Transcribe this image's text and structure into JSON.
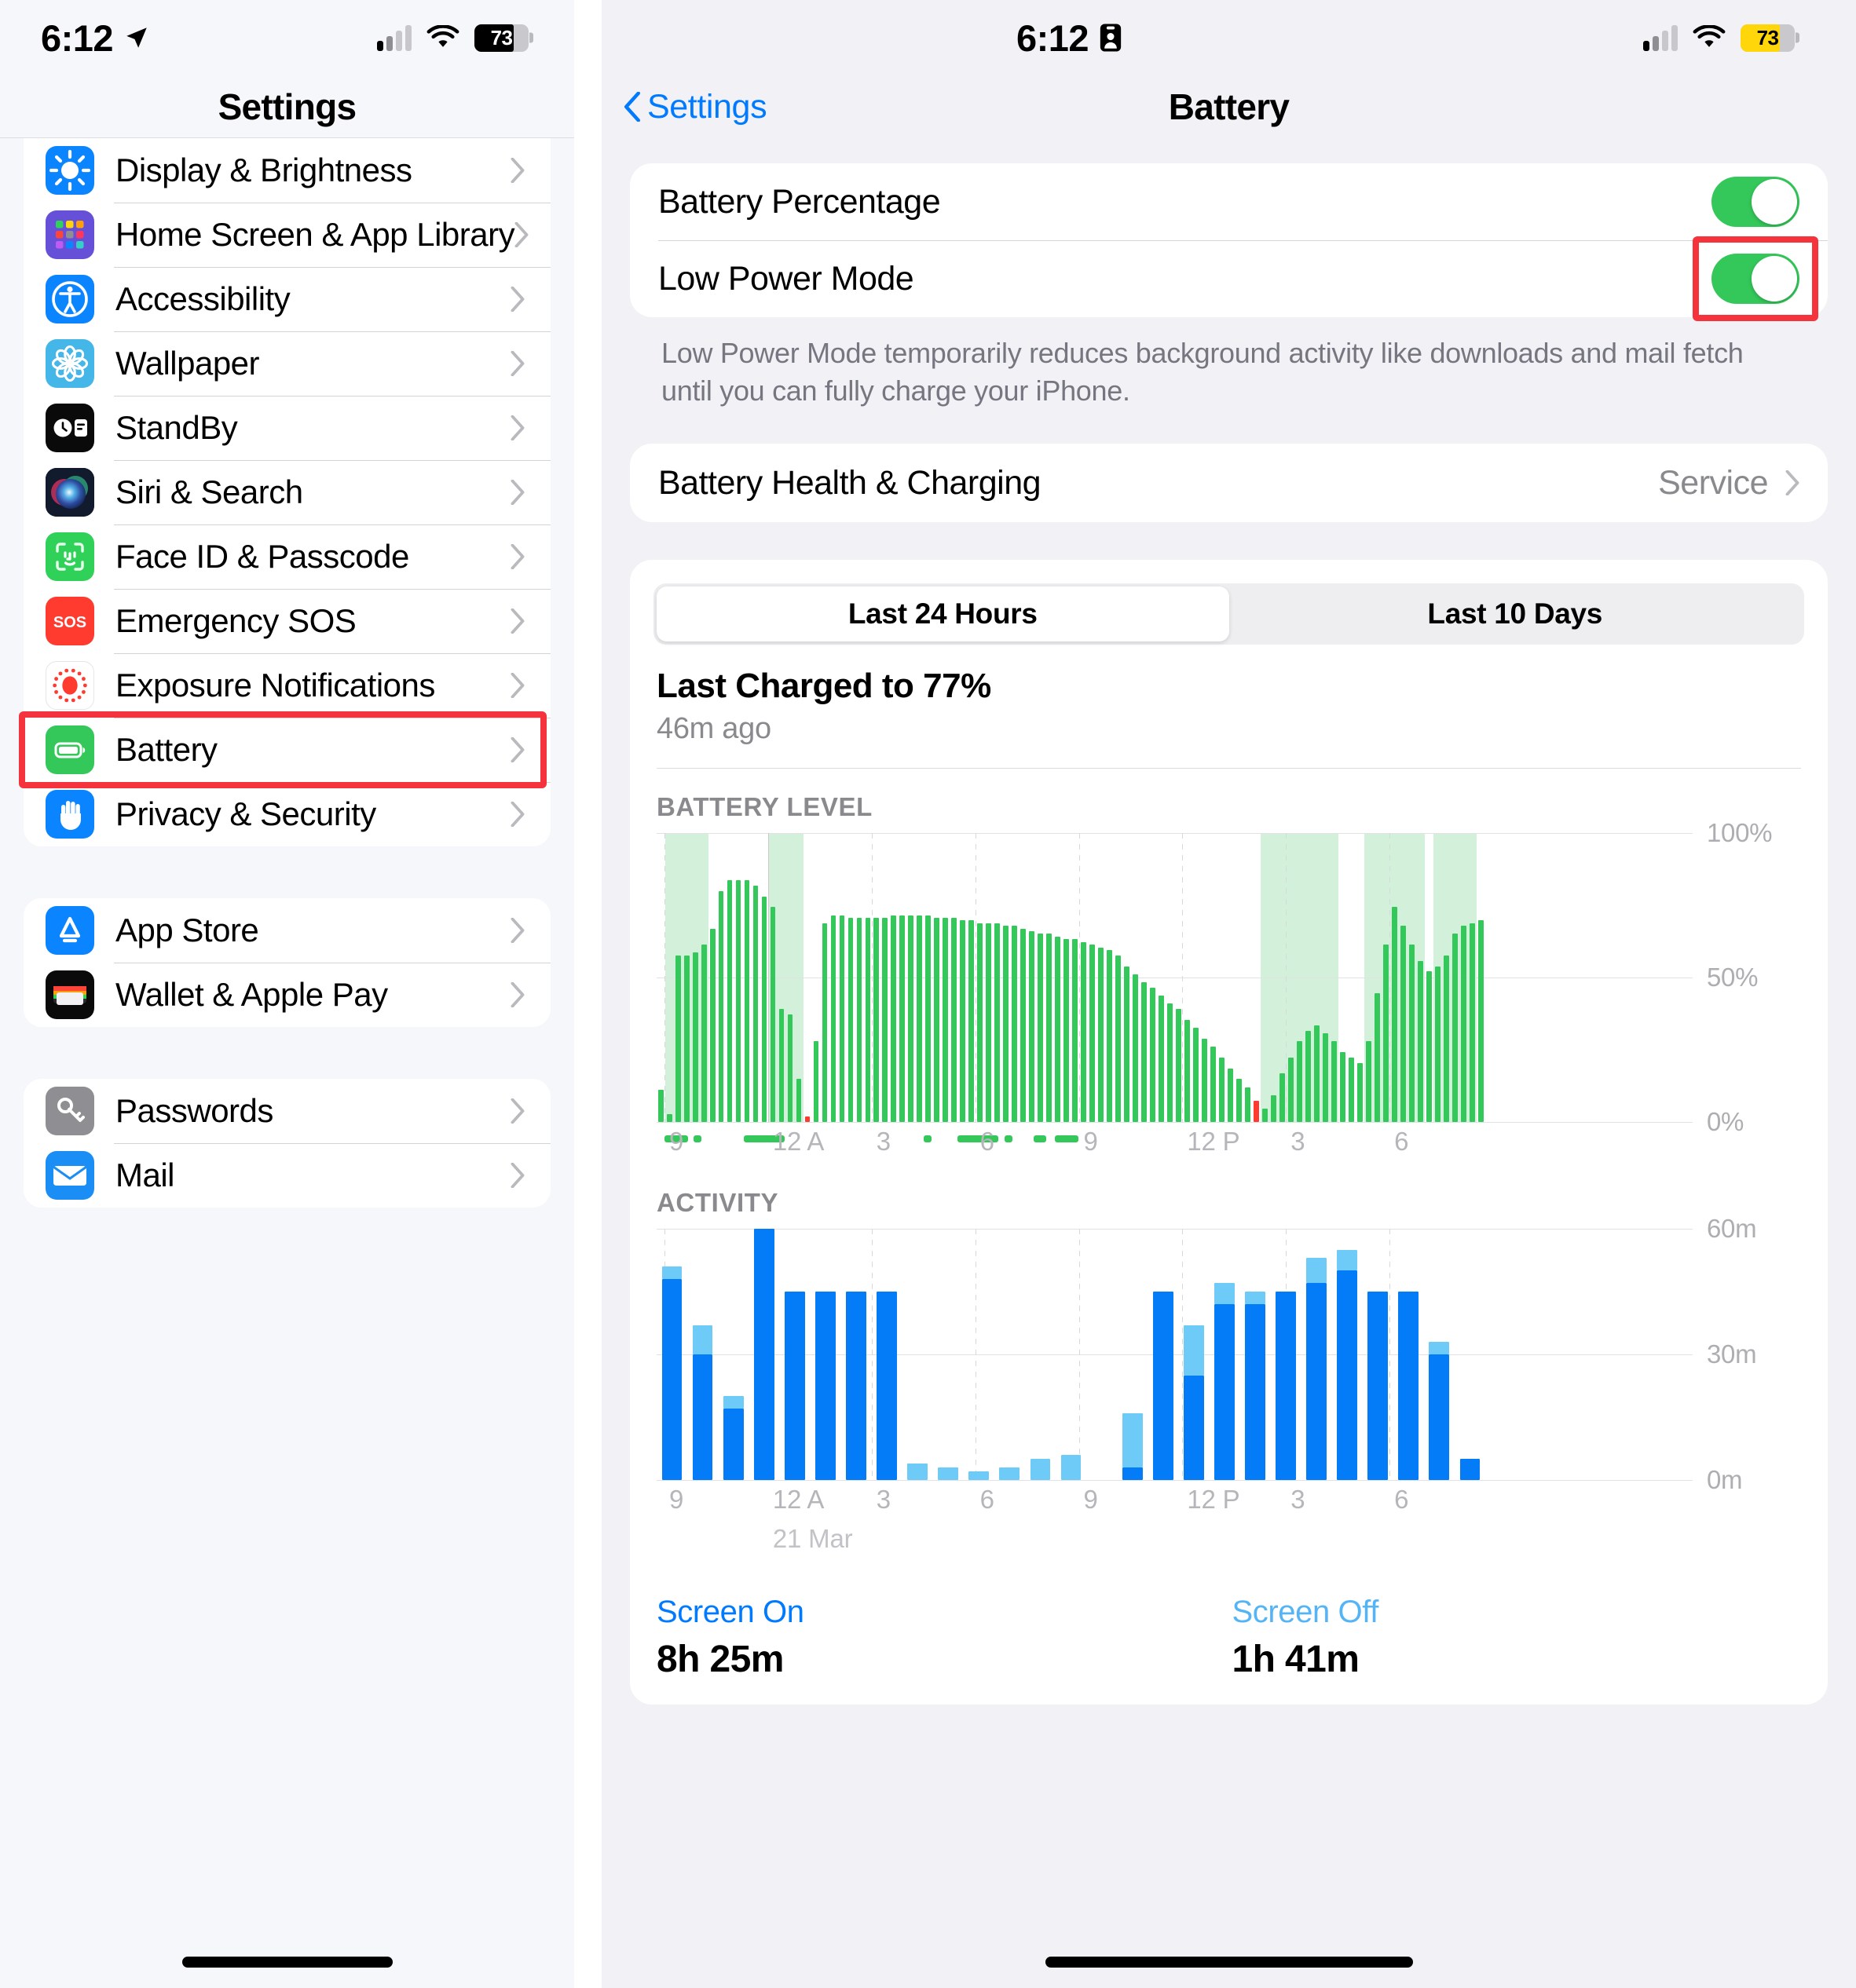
{
  "left_panel": {
    "status_bar": {
      "time": "6:12",
      "location_icon": "location-arrow-icon",
      "cellular_icon": "cellular-bars-icon",
      "wifi_icon": "wifi-icon",
      "battery_percent": "73",
      "battery_style": "dark"
    },
    "nav": {
      "title": "Settings"
    },
    "groups": [
      {
        "items": [
          {
            "label": "Display & Brightness",
            "icon": "display-brightness-icon"
          },
          {
            "label": "Home Screen & App Library",
            "icon": "home-screen-icon"
          },
          {
            "label": "Accessibility",
            "icon": "accessibility-icon"
          },
          {
            "label": "Wallpaper",
            "icon": "wallpaper-icon"
          },
          {
            "label": "StandBy",
            "icon": "standby-icon"
          },
          {
            "label": "Siri & Search",
            "icon": "siri-icon"
          },
          {
            "label": "Face ID & Passcode",
            "icon": "face-id-icon"
          },
          {
            "label": "Emergency SOS",
            "icon": "emergency-sos-icon"
          },
          {
            "label": "Exposure Notifications",
            "icon": "exposure-notifications-icon"
          },
          {
            "label": "Battery",
            "icon": "battery-icon"
          },
          {
            "label": "Privacy & Security",
            "icon": "privacy-security-icon"
          }
        ]
      },
      {
        "items": [
          {
            "label": "App Store",
            "icon": "app-store-icon"
          },
          {
            "label": "Wallet & Apple Pay",
            "icon": "wallet-icon"
          }
        ]
      },
      {
        "items": [
          {
            "label": "Passwords",
            "icon": "passwords-icon"
          },
          {
            "label": "Mail",
            "icon": "mail-icon"
          }
        ]
      }
    ],
    "highlight": {
      "target": "Battery",
      "color": "#f4333d"
    }
  },
  "right_panel": {
    "status_bar": {
      "time": "6:12",
      "badge_icon": "id-badge-icon",
      "cellular_icon": "cellular-bars-icon",
      "wifi_icon": "wifi-icon",
      "battery_percent": "73",
      "battery_style": "yellow-low-power"
    },
    "nav": {
      "back_label": "Settings",
      "title": "Battery"
    },
    "toggles": [
      {
        "label": "Battery Percentage",
        "state": "on"
      },
      {
        "label": "Low Power Mode",
        "state": "on",
        "highlighted": true
      }
    ],
    "footnote": "Low Power Mode temporarily reduces background activity like downloads and mail fetch until you can fully charge your iPhone.",
    "health_row": {
      "label": "Battery Health & Charging",
      "value": "Service"
    },
    "segmented": {
      "options": [
        "Last 24 Hours",
        "Last 10 Days"
      ],
      "selected": "Last 24 Hours"
    },
    "last_charged": {
      "title": "Last Charged to 77%",
      "subtitle": "46m ago"
    },
    "legend": {
      "screen_on_label": "Screen On",
      "screen_on_value": "8h 25m",
      "screen_off_label": "Screen Off",
      "screen_off_value": "1h 41m"
    },
    "highlight": {
      "target": "Low Power Mode toggle",
      "color": "#f4333d"
    }
  },
  "chart_data": [
    {
      "type": "bar",
      "id": "battery-level",
      "title": "BATTERY LEVEL",
      "ylabel": "",
      "ytick_labels": [
        "100%",
        "50%",
        "0%"
      ],
      "ylim": [
        0,
        100
      ],
      "xtick_labels": [
        "9",
        "12 A",
        "3",
        "6",
        "9",
        "12 P",
        "3",
        "6"
      ],
      "date_label": "",
      "grid": true,
      "legend": "none",
      "colors": {
        "bar": "#34c759",
        "low": "#ff3b30",
        "charging_band": "#d3f0da"
      },
      "values": [
        12,
        3,
        62,
        62,
        63,
        66,
        72,
        86,
        90,
        90,
        90,
        88,
        84,
        80,
        42,
        40,
        16,
        2,
        30,
        74,
        77,
        77,
        76,
        76,
        76,
        76,
        76,
        77,
        77,
        77,
        77,
        77,
        76,
        76,
        76,
        75,
        75,
        74,
        74,
        74,
        73,
        73,
        72,
        71,
        70,
        70,
        69,
        68,
        68,
        67,
        66,
        65,
        64,
        62,
        58,
        55,
        52,
        50,
        47,
        44,
        42,
        38,
        35,
        31,
        28,
        24,
        20,
        16,
        13,
        8,
        5,
        10,
        18,
        24,
        30,
        34,
        36,
        33,
        30,
        26,
        24,
        22,
        30,
        48,
        66,
        80,
        73,
        66,
        60,
        56,
        58,
        62,
        70,
        73,
        74,
        75
      ],
      "low_indices": [
        17,
        69
      ],
      "charging_bands": [
        [
          1,
          5
        ],
        [
          13,
          16
        ],
        [
          70,
          78
        ],
        [
          82,
          88
        ],
        [
          90,
          94
        ]
      ]
    },
    {
      "type": "bar",
      "id": "activity",
      "title": "ACTIVITY",
      "ylabel": "",
      "ytick_labels": [
        "60m",
        "30m",
        "0m"
      ],
      "ylim": [
        0,
        60
      ],
      "xtick_labels": [
        "9",
        "12 A",
        "3",
        "6",
        "9",
        "12 P",
        "3",
        "6"
      ],
      "date_label": "21 Mar",
      "grid": true,
      "legend": "Screen On / Screen Off",
      "colors": {
        "screen_on": "#047cf8",
        "screen_off": "#6ecbf8"
      },
      "series": [
        {
          "name": "Screen On",
          "values": [
            48,
            30,
            17,
            60,
            45,
            45,
            45,
            45,
            0,
            0,
            0,
            0,
            0,
            0,
            0,
            3,
            45,
            25,
            42,
            42,
            45,
            47,
            50,
            45,
            45,
            30,
            5
          ]
        },
        {
          "name": "Screen Off",
          "values": [
            3,
            7,
            3,
            0,
            0,
            0,
            0,
            0,
            4,
            3,
            2,
            3,
            5,
            6,
            0,
            13,
            0,
            12,
            5,
            3,
            0,
            6,
            5,
            0,
            0,
            3,
            0
          ]
        }
      ]
    }
  ]
}
